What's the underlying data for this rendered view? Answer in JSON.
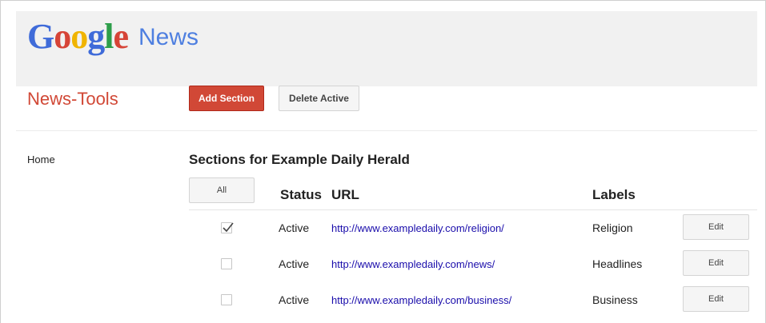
{
  "header": {
    "logo": {
      "g1": "G",
      "o1": "o",
      "o2": "o",
      "g2": "g",
      "l": "l",
      "e": "e"
    },
    "product": "News",
    "colors": {
      "blue": "#3f6bd9",
      "red": "#d64437",
      "yellow": "#f0b400",
      "green": "#2d9e4a"
    }
  },
  "toolbar": {
    "brand_title": "News-Tools",
    "add_section_label": "Add Section",
    "delete_active_label": "Delete Active",
    "accent_color": "#d14836"
  },
  "sidebar": {
    "items": [
      {
        "label": "Home"
      }
    ]
  },
  "main": {
    "section_title": "Sections for Example Daily Herald",
    "all_button_label": "All",
    "columns": {
      "status": "Status",
      "url": "URL",
      "labels": "Labels"
    },
    "rows": [
      {
        "checked": true,
        "status": "Active",
        "url": "http://www.exampledaily.com/religion/",
        "label": "Religion",
        "edit_label": "Edit"
      },
      {
        "checked": false,
        "status": "Active",
        "url": "http://www.exampledaily.com/news/",
        "label": "Headlines",
        "edit_label": "Edit"
      },
      {
        "checked": false,
        "status": "Active",
        "url": "http://www.exampledaily.com/business/",
        "label": "Business",
        "edit_label": "Edit"
      }
    ]
  }
}
